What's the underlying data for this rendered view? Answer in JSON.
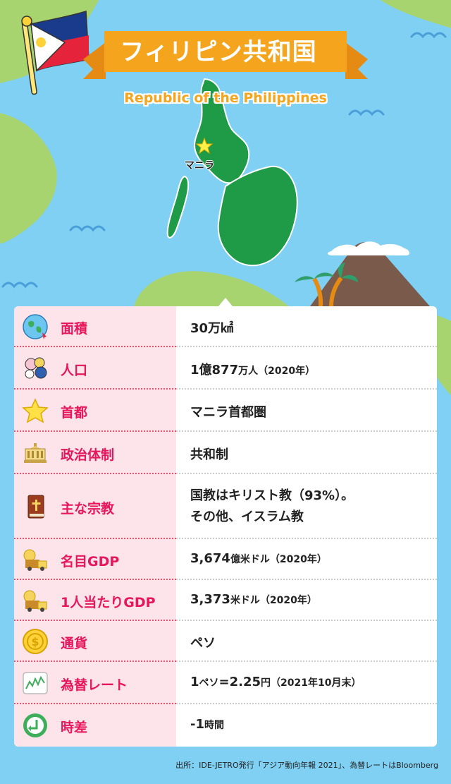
{
  "title": "フィリピン共和国",
  "subtitle": "Republic of the Philippines",
  "capital_label": "マニラ",
  "rows": [
    {
      "icon": "globe-icon",
      "label": "面積",
      "value": "30万㎢"
    },
    {
      "icon": "people-icon",
      "label": "人口",
      "value_main": "1億877",
      "value_small": "万人（2020年）"
    },
    {
      "icon": "star-icon",
      "label": "首都",
      "value": "マニラ首都圏"
    },
    {
      "icon": "parliament-icon",
      "label": "政治体制",
      "value": "共和制"
    },
    {
      "icon": "bible-icon",
      "label": "主な宗教",
      "value_line1": "国教はキリスト教（93%）。",
      "value_line2": "その他、イスラム教"
    },
    {
      "icon": "money-truck-icon",
      "label": "名目GDP",
      "value_main": "3,674",
      "value_small": "億米ドル（2020年）"
    },
    {
      "icon": "money-truck-icon",
      "label": "1人当たりGDP",
      "value_main": "3,373",
      "value_small": "米ドル（2020年）"
    },
    {
      "icon": "coin-icon",
      "label": "通貨",
      "value": "ペソ"
    },
    {
      "icon": "chart-icon",
      "label": "為替レート",
      "value_a": "1",
      "value_b": "ペソ",
      "value_c": "=2.25",
      "value_d": "円（2021年10月末）"
    },
    {
      "icon": "clock-arrow-icon",
      "label": "時差",
      "value_main": "-1",
      "value_small": "時間"
    }
  ],
  "source": "出所：IDE-JETRO発行「アジア動向年報 2021」、為替レートはBloomberg",
  "colors": {
    "sea": "#7fd0f3",
    "land": "#a8d46f",
    "philippines": "#1f9a46",
    "ribbon": "#f4a41d",
    "label_bg": "#fde3ea",
    "label_text": "#e6175c"
  }
}
